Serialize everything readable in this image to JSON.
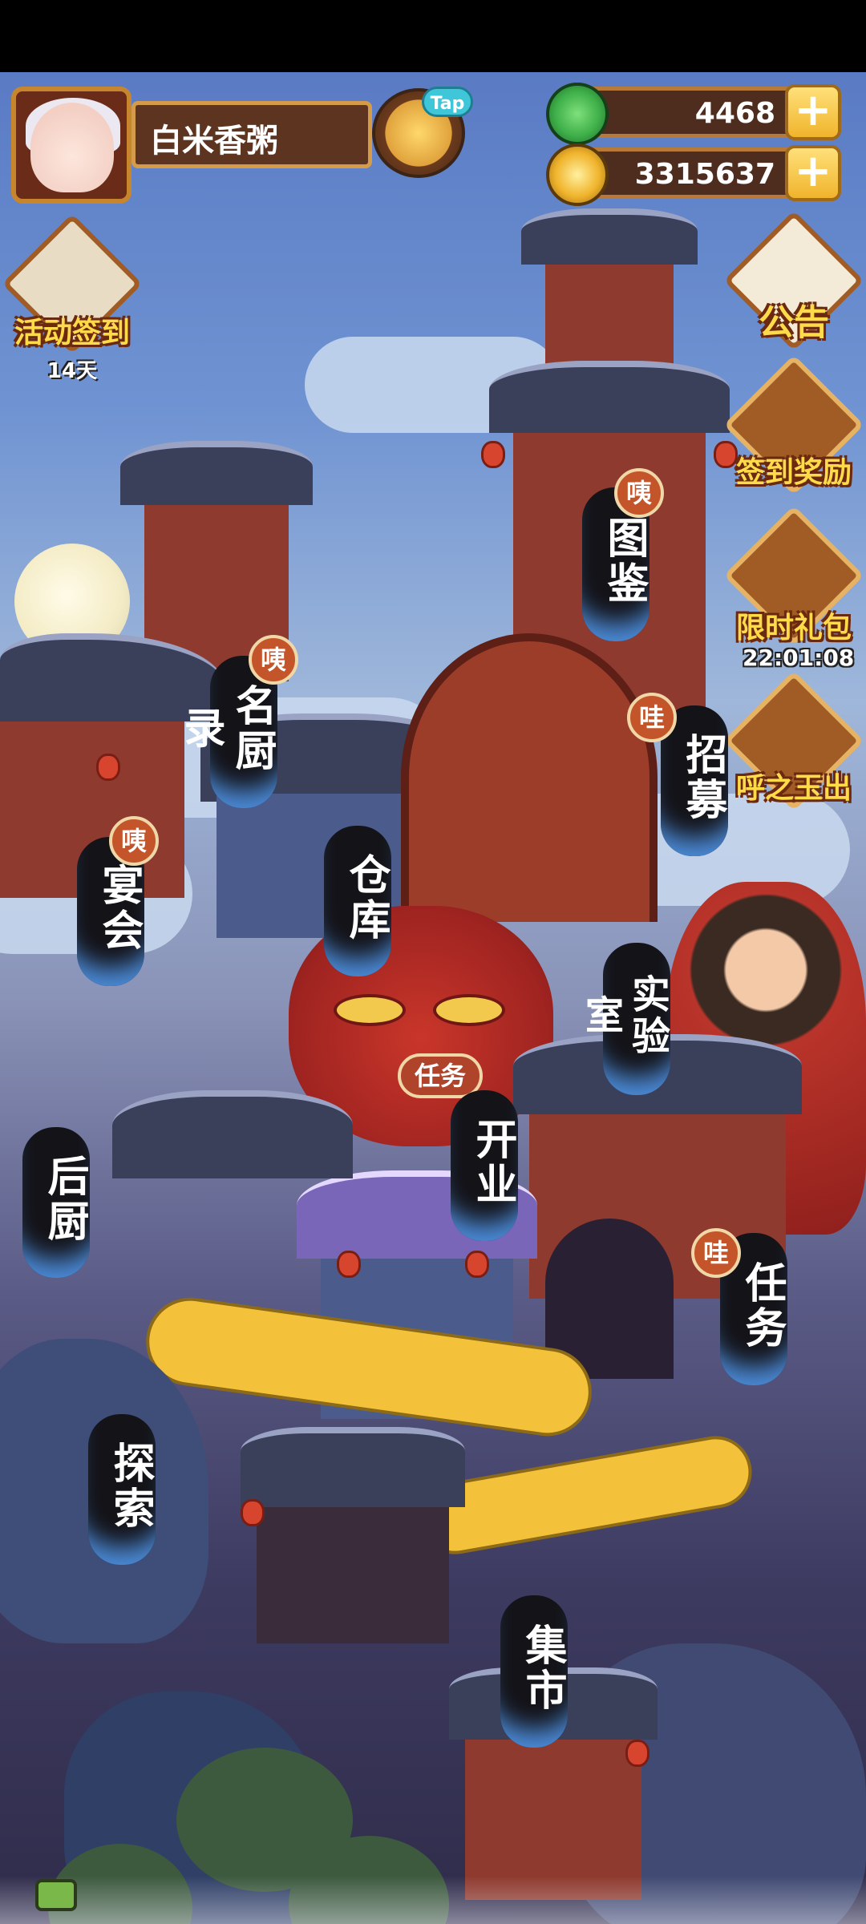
{
  "player": {
    "name": "白米香粥",
    "tap_label": "Tap"
  },
  "currencies": [
    {
      "name": "jade",
      "amount": "4468",
      "icon": "jade-icon",
      "color": "#3fb04a"
    },
    {
      "name": "coin",
      "amount": "3315637",
      "icon": "coin-icon",
      "color": "#f0b42c"
    }
  ],
  "left_buttons": {
    "checkin": {
      "label": "活动签到",
      "sub": "14天",
      "icon": "checkin-scroll-icon"
    }
  },
  "right_buttons": [
    {
      "key": "notice",
      "label": "公告",
      "sub": "",
      "icon": "notice-icon"
    },
    {
      "key": "signin_reward",
      "label": "签到奖励",
      "sub": "",
      "icon": "reward-chest-icon"
    },
    {
      "key": "gift",
      "label": "限时礼包",
      "sub": "22:01:08",
      "icon": "gift-box-icon"
    },
    {
      "key": "jade_event",
      "label": "呼之玉出",
      "sub": "",
      "icon": "jade-pendant-icon"
    }
  ],
  "locations": [
    {
      "key": "tujian",
      "text": "图鉴",
      "badge": "咦"
    },
    {
      "key": "mingchu",
      "text": "名厨录",
      "badge": "咦"
    },
    {
      "key": "zhaomu",
      "text": "招募",
      "badge": "哇"
    },
    {
      "key": "yanhui",
      "text": "宴会",
      "badge": "咦"
    },
    {
      "key": "cangku",
      "text": "仓库",
      "badge": ""
    },
    {
      "key": "shiyan",
      "text": "实验室",
      "badge": ""
    },
    {
      "key": "kaiye",
      "text": "开业",
      "badge": ""
    },
    {
      "key": "houchu",
      "text": "后厨",
      "badge": ""
    },
    {
      "key": "renwu",
      "text": "任务",
      "badge": "哇"
    },
    {
      "key": "tansuo",
      "text": "探索",
      "badge": ""
    },
    {
      "key": "jishi",
      "text": "集市",
      "badge": ""
    }
  ],
  "task_pill": "任务",
  "colors": {
    "label_bg": "#141318",
    "label_glow": "#4b8ad6",
    "gold_text": "#ffdb4a",
    "badge_bg": "#c4552a"
  }
}
